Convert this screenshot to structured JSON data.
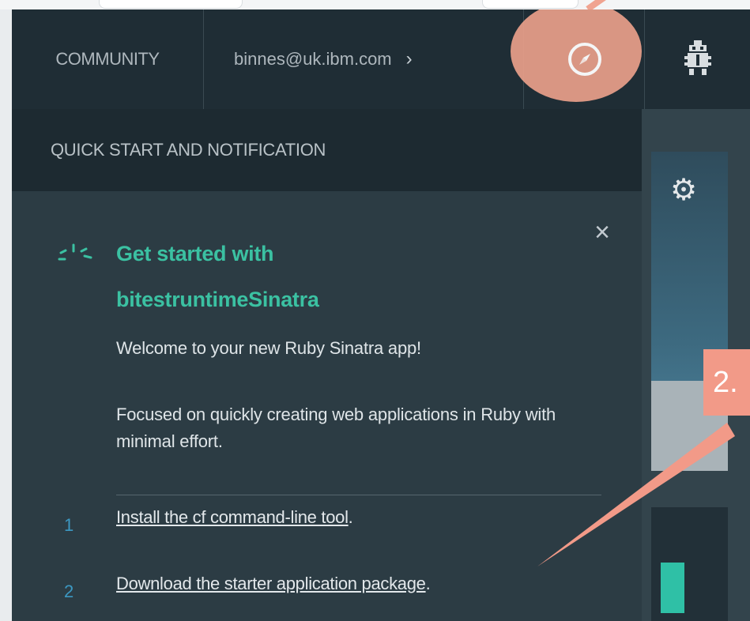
{
  "topbar": {
    "community_label": "COMMUNITY",
    "user_email": "binnes@uk.ibm.com",
    "user_chevron": "›",
    "compass_icon": "compass-icon",
    "bug_icon": "bug-icon"
  },
  "panel": {
    "header": "QUICK START AND NOTIFICATION",
    "close_symbol": "×",
    "title_line1": "Get started with",
    "title_line2": "bitestruntimeSinatra",
    "welcome": "Welcome to your new Ruby Sinatra app!",
    "description": "Focused on quickly creating web applications in Ruby with minimal effort.",
    "steps": [
      {
        "number": "1",
        "link": "Install the cf command-line tool",
        "suffix": "."
      },
      {
        "number": "2",
        "link": "Download the starter application package",
        "suffix": "."
      }
    ]
  },
  "annotation": {
    "callout_label": "2."
  },
  "colors": {
    "accent_teal": "#3bc1a2",
    "step_number_blue": "#3c98c2",
    "highlight_salmon": "#f29a88"
  }
}
